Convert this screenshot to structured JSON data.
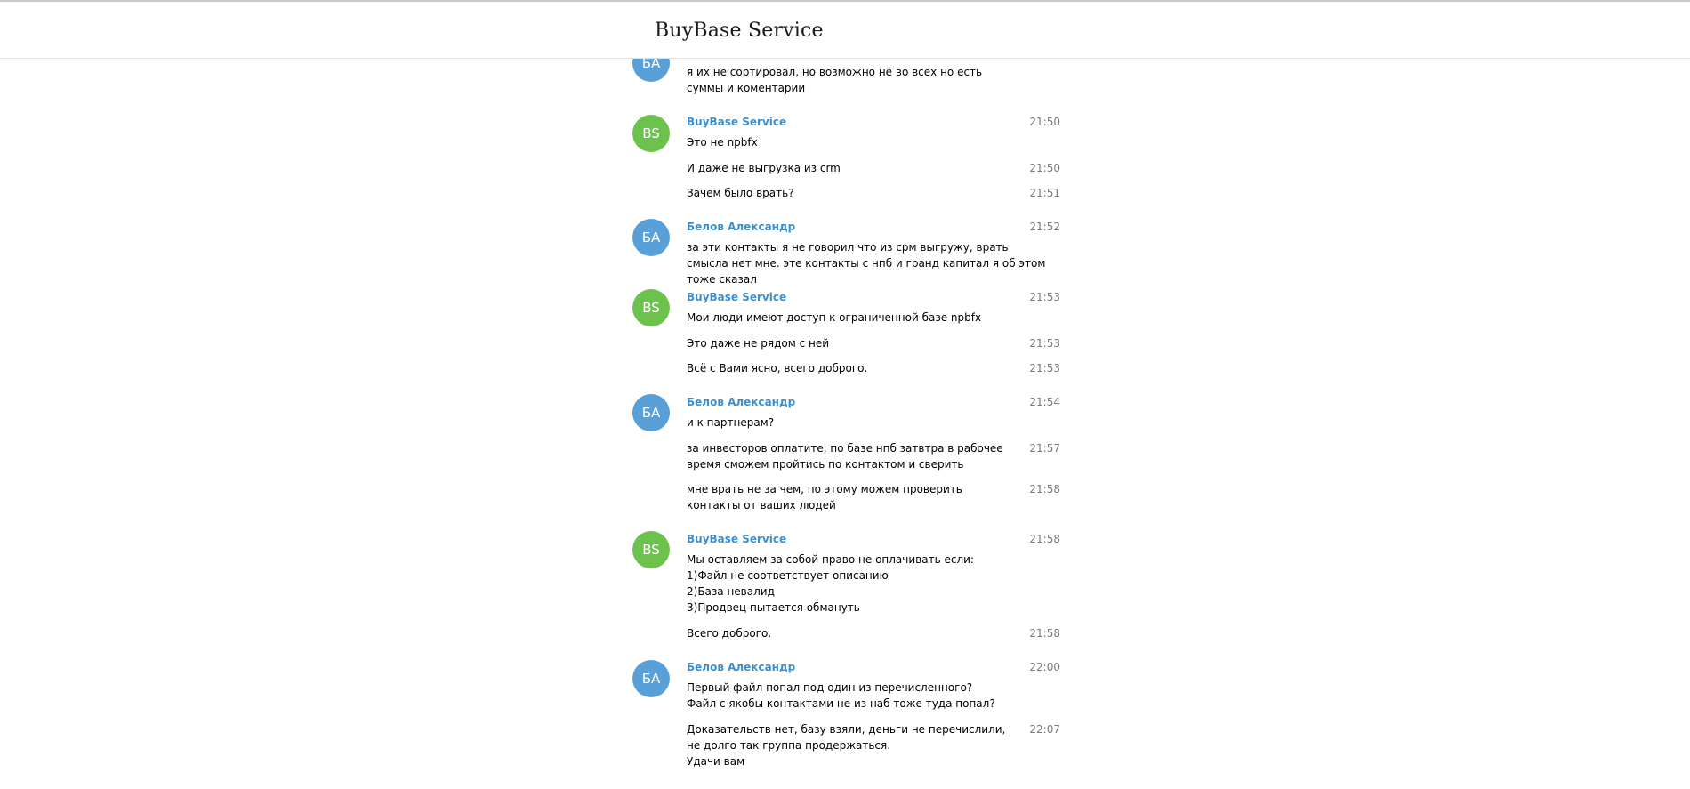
{
  "header": {
    "title": "BuyBase Service"
  },
  "colors": {
    "name": "#3b8fd1",
    "avatar_blue": "#5aa0d8",
    "avatar_green": "#6dc24d",
    "time": "#7a7a7a"
  },
  "avatars": {
    "a0": "БА",
    "a1": "BS",
    "a2": "БА",
    "a3": "BS",
    "a4": "БА",
    "a5": "BS",
    "a6": "БА"
  },
  "messages": [
    {
      "text": "я их не сортировал, но возможно не во всех но есть суммы и коментарии",
      "time": ""
    },
    {
      "sender": "BuyBase Service",
      "text": "Это не npbfx",
      "time": "21:50"
    },
    {
      "text": "И даже не выгрузка из crm",
      "time": "21:50"
    },
    {
      "text": "Зачем было врать?",
      "time": "21:51"
    },
    {
      "sender": "Белов Александр",
      "text": "за эти контакты я не говорил что из срм выгружу, врать смысла нет мне. эте контакты с нпб и гранд капитал я об этом тоже сказал",
      "time": "21:52"
    },
    {
      "sender": "BuyBase Service",
      "text": "Мои люди имеют доступ к ограниченной базе npbfx",
      "time": "21:53"
    },
    {
      "text": "Это даже не рядом с ней",
      "time": "21:53"
    },
    {
      "text": "Всё с Вами ясно, всего доброго.",
      "time": "21:53"
    },
    {
      "sender": "Белов Александр",
      "text": "и к партнерам?",
      "time": "21:54"
    },
    {
      "text": "за инвесторов оплатите, по базе нпб затвтра в рабочее время сможем пройтись по контактом и сверить",
      "time": "21:57"
    },
    {
      "text": "мне врать не за чем, по этому можем проверить контакты от ваших людей",
      "time": "21:58"
    },
    {
      "sender": "BuyBase Service",
      "text": "Мы оставляем за собой право не оплачивать если:\n1)Файл не соответствует описанию\n2)База невалид\n3)Продвец пытается обмануть",
      "time": "21:58"
    },
    {
      "text": "Всего доброго.",
      "time": "21:58"
    },
    {
      "sender": "Белов Александр",
      "text": "Первый файл попал под один из перечисленного?\nФайл с якобы контактами не из наб тоже туда попал?",
      "time": "22:00"
    },
    {
      "text": "Доказательств нет, базу взяли, деньги не перечислили, не долго так группа продержаться.\nУдачи вам",
      "time": "22:07"
    }
  ]
}
